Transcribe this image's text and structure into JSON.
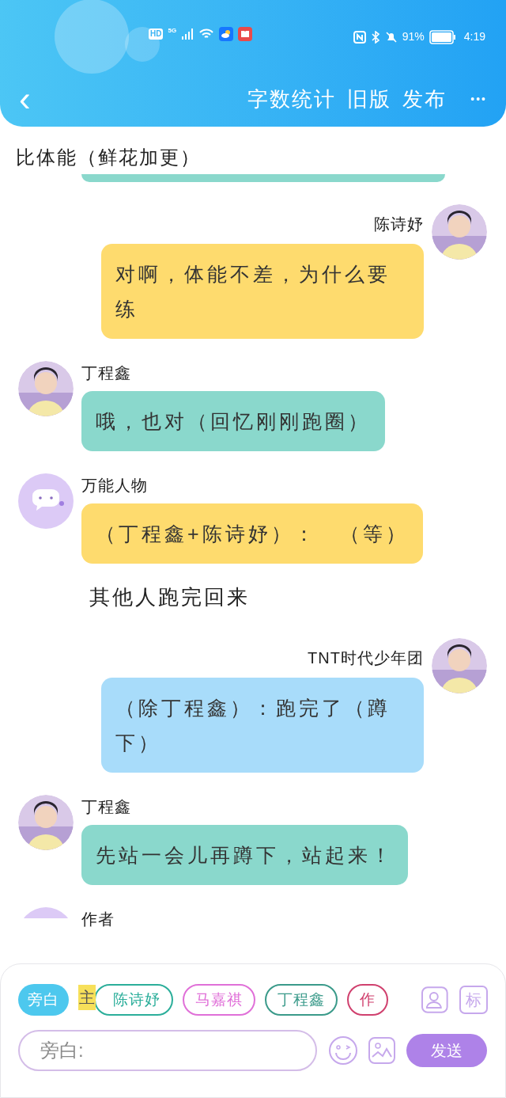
{
  "status_bar": {
    "hd": "HD",
    "network": "5G",
    "battery": "91%",
    "time": "4:19"
  },
  "nav": {
    "back": "‹",
    "actions": [
      "字数统计",
      "旧版",
      "发布"
    ],
    "more": "•••"
  },
  "title": "比体能（鲜花加更）",
  "messages": [
    {
      "kind": "fragment",
      "color": "#8ad8cc"
    },
    {
      "kind": "right",
      "author": "陈诗妤",
      "text": "对啊，体能不差，为什么要练",
      "color": "#fedb6e"
    },
    {
      "kind": "left",
      "author": "丁程鑫",
      "text": "哦，也对（回忆刚刚跑圈）",
      "color": "#8ad8cc"
    },
    {
      "kind": "left",
      "author": "万能人物",
      "avatar": {
        "kind": "icon"
      },
      "text": "（丁程鑫+陈诗妤）：　（等）",
      "color": "#fedb6e"
    },
    {
      "kind": "narration",
      "text": "其他人跑完回来"
    },
    {
      "kind": "right",
      "author": "TNT时代少年团",
      "text": "（除丁程鑫）：跑完了（蹲下）",
      "color": "#a8dcfa"
    },
    {
      "kind": "left",
      "author": "丁程鑫",
      "text": "先站一会儿再蹲下，站起来！",
      "color": "#8ad8cc"
    },
    {
      "kind": "left",
      "author": "作者",
      "avatar": {
        "kind": "blank"
      }
    }
  ],
  "roles": [
    {
      "label": "旁白",
      "color": "#4dc8ee",
      "selected": true,
      "main": false
    },
    {
      "label": "陈诗妤",
      "color": "#2bae9a",
      "selected": false,
      "main": true,
      "badge": "主"
    },
    {
      "label": "马嘉祺",
      "color": "#e070d8",
      "selected": false,
      "main": false
    },
    {
      "label": "丁程鑫",
      "color": "#3a9a8a",
      "selected": false,
      "main": false
    },
    {
      "label": "作",
      "color": "#d0406e",
      "selected": false,
      "main": false
    }
  ],
  "tag_button": "标",
  "input": {
    "placeholder": "旁白:"
  },
  "send": "发送"
}
